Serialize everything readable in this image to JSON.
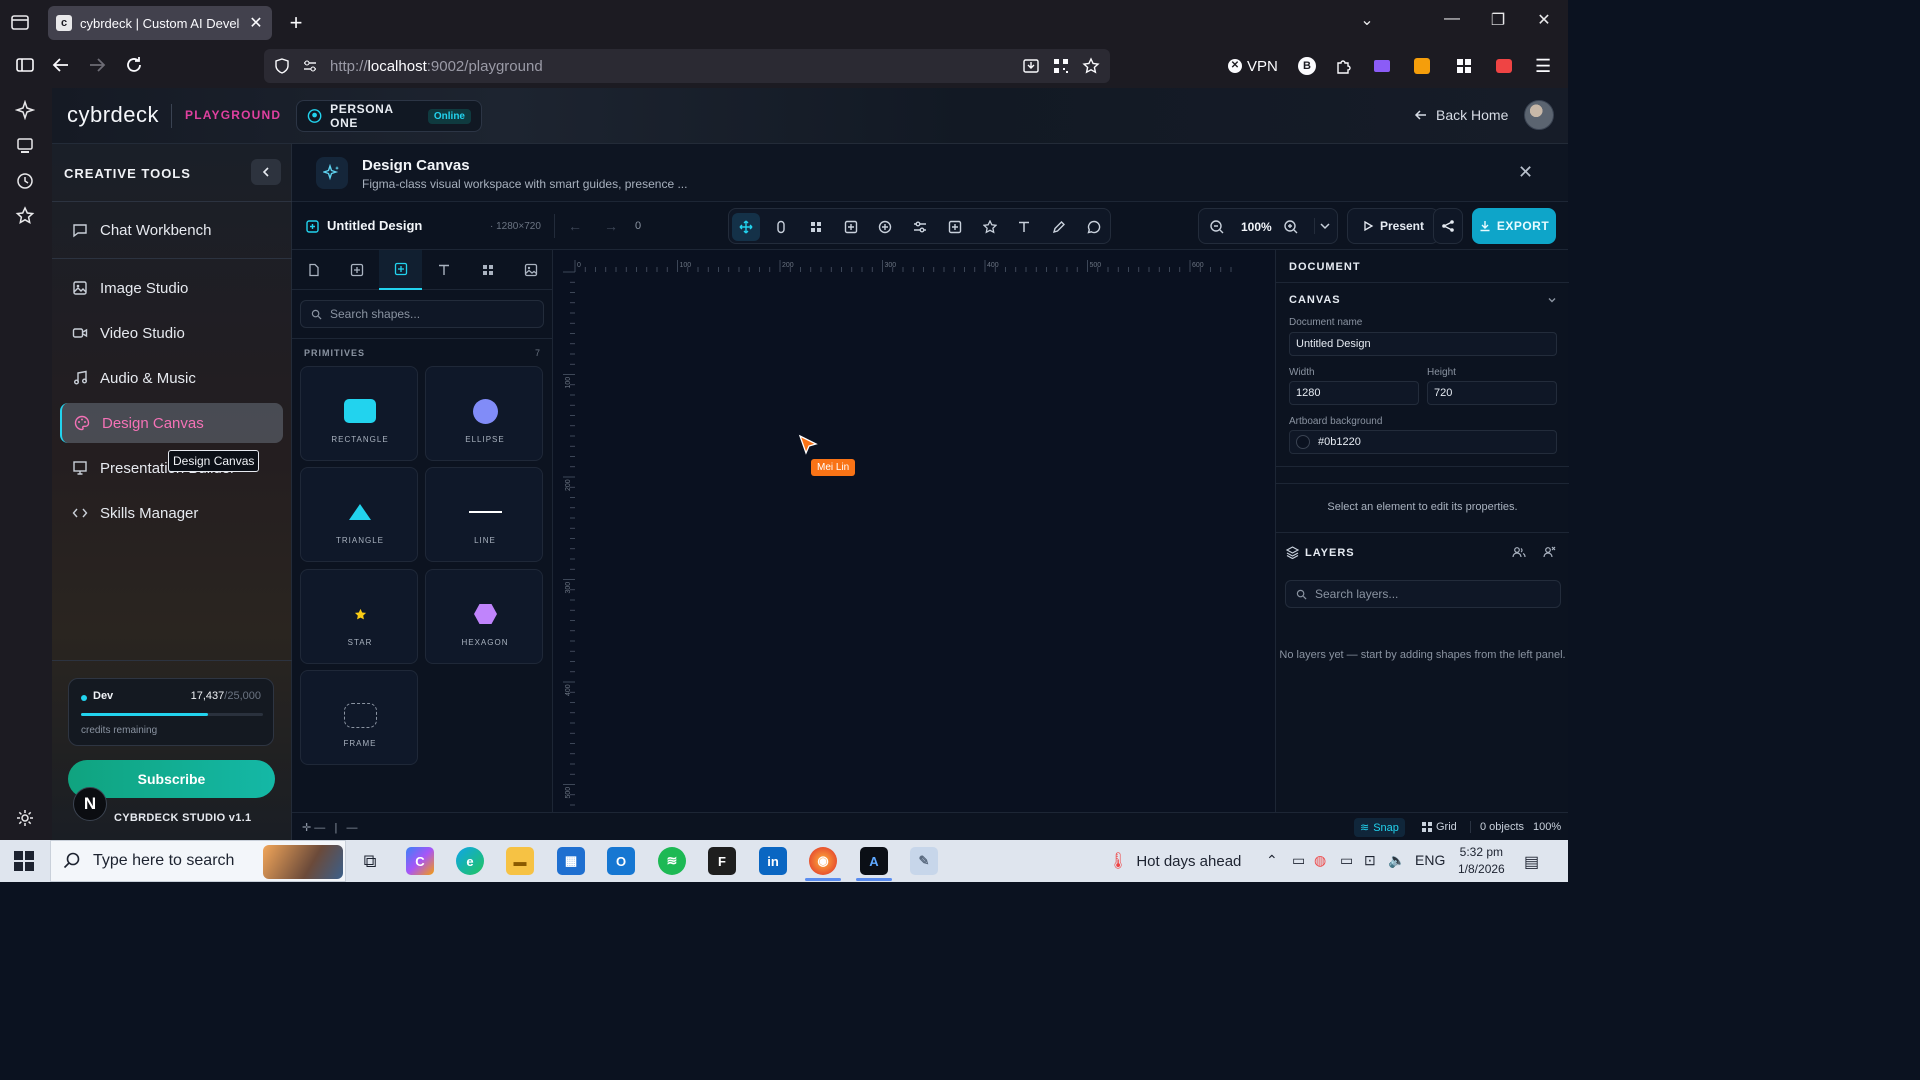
{
  "browser": {
    "tab_title": "cybrdeck | Custom AI Developm",
    "url_prefix": "http://",
    "url_host": "localhost",
    "url_rest": ":9002/playground",
    "vpn_label": "VPN"
  },
  "header": {
    "logo": "cybrdeck",
    "section": "PLAYGROUND",
    "persona": "PERSONA ONE",
    "persona_status": "Online",
    "back_home": "Back Home"
  },
  "sidebar": {
    "title": "CREATIVE TOOLS",
    "items": [
      {
        "label": "Chat Workbench",
        "icon": "chat-icon"
      },
      {
        "label": "Image Studio",
        "icon": "image-icon"
      },
      {
        "label": "Video Studio",
        "icon": "video-icon"
      },
      {
        "label": "Audio & Music",
        "icon": "music-icon"
      },
      {
        "label": "Design Canvas",
        "icon": "palette-icon",
        "active": true
      },
      {
        "label": "Presentation Builder",
        "icon": "presentation-icon"
      },
      {
        "label": "Skills Manager",
        "icon": "code-icon"
      }
    ],
    "tooltip": "Design Canvas",
    "credits": {
      "plan": "Dev",
      "used": "17,437",
      "total": "/25,000",
      "fraction": 0.697,
      "label": "credits remaining"
    },
    "subscribe": "Subscribe",
    "avatar_letter": "N",
    "version": "CYBRDECK STUDIO v1.1"
  },
  "tool": {
    "title": "Design Canvas",
    "subtitle": "Figma-class visual workspace with smart guides, presence ..."
  },
  "toolbar": {
    "doc_name": "Untitled Design",
    "doc_size": "1280×720",
    "history_count": "0",
    "tools": [
      "move-icon",
      "select-icon",
      "components-icon",
      "frame-icon",
      "target-icon",
      "adjust-icon",
      "add-shape-icon",
      "star-icon",
      "text-icon",
      "pen-icon",
      "comment-icon"
    ],
    "zoom": "100%",
    "present": "Present",
    "export": "EXPORT"
  },
  "shapes_panel": {
    "tabs": [
      "page-icon",
      "frame-icon",
      "shapes-icon",
      "text-icon",
      "components-icon",
      "image-icon"
    ],
    "search_placeholder": "Search shapes...",
    "section": "PRIMITIVES",
    "count": "7",
    "shapes": [
      {
        "label": "RECTANGLE",
        "color": "#22d3ee"
      },
      {
        "label": "ELLIPSE",
        "color": "#818cf8"
      },
      {
        "label": "TRIANGLE",
        "color": "#22d3ee"
      },
      {
        "label": "LINE",
        "color": "#ffffff"
      },
      {
        "label": "STAR",
        "color": "#facc15"
      },
      {
        "label": "HEXAGON",
        "color": "#c084fc"
      },
      {
        "label": "FRAME",
        "color": "#8a93a1"
      }
    ]
  },
  "canvas": {
    "ruler_top": [
      "0",
      "100",
      "200",
      "300",
      "400",
      "500",
      "600"
    ],
    "ruler_left": [
      "100",
      "200",
      "300",
      "400",
      "500"
    ],
    "presence_user": "Mei Lin",
    "presence_color": "#f97316"
  },
  "properties": {
    "document_title": "DOCUMENT",
    "canvas_title": "CANVAS",
    "name_label": "Document name",
    "name_value": "Untitled Design",
    "width_label": "Width",
    "width_value": "1280",
    "height_label": "Height",
    "height_value": "720",
    "bg_label": "Artboard background",
    "bg_value": "#0b1220",
    "hint": "Select an element to edit its properties.",
    "layers_title": "LAYERS",
    "layers_search": "Search layers...",
    "layers_empty": "No layers yet — start by adding shapes from the left panel."
  },
  "statusbar": {
    "snap": "Snap",
    "grid": "Grid",
    "objects": "0 objects",
    "zoom": "100%"
  },
  "taskbar": {
    "search_placeholder": "Type here to search",
    "weather": "Hot days ahead",
    "lang": "ENG",
    "time": "5:32 pm",
    "date": "1/8/2026"
  }
}
